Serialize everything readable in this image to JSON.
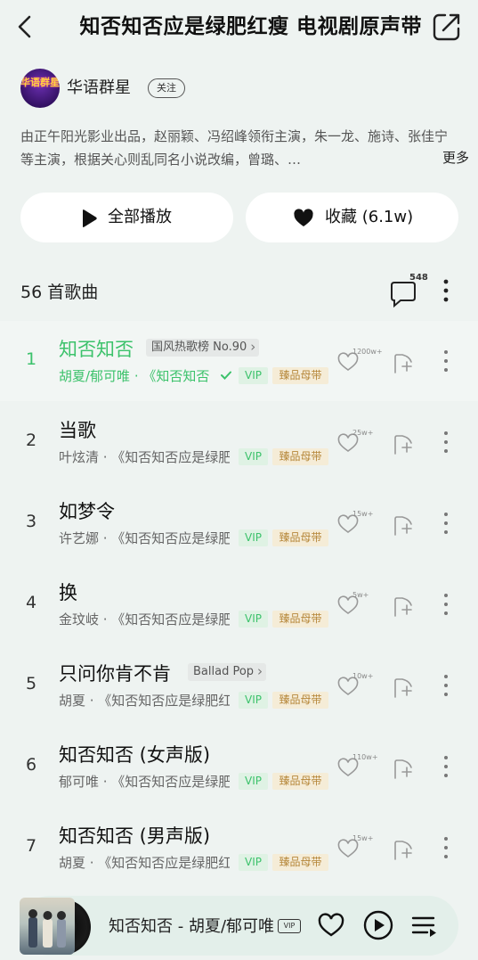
{
  "header": {
    "title": "知否知否应是绿肥红瘦 电视剧原声带",
    "back_icon": "chevron-left-icon",
    "share_icon": "share-icon"
  },
  "artist": {
    "avatar_text": "华语群星",
    "name": "华语群星",
    "follow_label": "关注"
  },
  "description": {
    "text": "由正午阳光影业出品，赵丽颖、冯绍峰领衔主演，朱一龙、施诗、张佳宁等主演，根据关心则乱同名小说改编，曾璐、…",
    "more_label": "更多"
  },
  "actions": {
    "play_all_label": "全部播放",
    "favorite_label": "收藏 (6.1w)"
  },
  "songs_header": {
    "count_label": "56 首歌曲",
    "comment_count": "548"
  },
  "songs": [
    {
      "index": "1",
      "title": "知否知否",
      "tag": "国风热歌榜 No.90",
      "subtitle": "胡夏/郁可唯 · 《知否知否应是绿肥红瘦",
      "vip": "VIP",
      "master": "臻品母带",
      "likes": "1200w+",
      "active": true,
      "downloaded": true
    },
    {
      "index": "2",
      "title": "当歌",
      "tag": "",
      "subtitle": "叶炫清 · 《知否知否应是绿肥红瘦",
      "vip": "VIP",
      "master": "臻品母带",
      "likes": "25w+"
    },
    {
      "index": "3",
      "title": "如梦令",
      "tag": "",
      "subtitle": "许艺娜 · 《知否知否应是绿肥红瘦",
      "vip": "VIP",
      "master": "臻品母带",
      "likes": "15w+"
    },
    {
      "index": "4",
      "title": "换",
      "tag": "",
      "subtitle": "金玟岐 · 《知否知否应是绿肥红瘦",
      "vip": "VIP",
      "master": "臻品母带",
      "likes": "5w+"
    },
    {
      "index": "5",
      "title": "只问你肯不肯",
      "tag": "Ballad Pop",
      "subtitle": "胡夏 · 《知否知否应是绿肥红瘦",
      "vip": "VIP",
      "master": "臻品母带",
      "likes": "10w+"
    },
    {
      "index": "6",
      "title": "知否知否 (女声版)",
      "tag": "",
      "subtitle": "郁可唯 · 《知否知否应是绿肥红瘦",
      "vip": "VIP",
      "master": "臻品母带",
      "likes": "110w+"
    },
    {
      "index": "7",
      "title": "知否知否 (男声版)",
      "tag": "",
      "subtitle": "胡夏 · 《知否知否应是绿肥红瘦",
      "vip": "VIP",
      "master": "臻品母带",
      "likes": "15w+"
    }
  ],
  "player": {
    "now_playing": "知否知否 - 胡夏/郁可唯",
    "vip_label": "VIP",
    "icons": [
      "heart-icon",
      "play-icon",
      "queue-icon"
    ]
  },
  "colors": {
    "accent_green": "#3cc26b",
    "background": "#eef3f1",
    "vip_bg": "#dff2e4",
    "master_bg": "#f5ecd7",
    "master_text": "#b6873a"
  }
}
